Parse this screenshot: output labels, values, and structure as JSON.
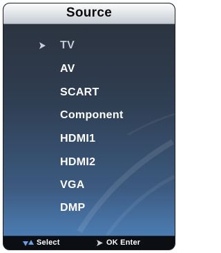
{
  "menu": {
    "title": "Source",
    "items": [
      {
        "label": "TV",
        "selected": true
      },
      {
        "label": "AV"
      },
      {
        "label": "SCART"
      },
      {
        "label": "Component"
      },
      {
        "label": "HDMI1"
      },
      {
        "label": "HDMI2"
      },
      {
        "label": "VGA"
      },
      {
        "label": "DMP"
      }
    ]
  },
  "footer": {
    "select_label": "Select",
    "enter_label": "OK Enter"
  },
  "icons": {
    "selection": "arrow-right-icon",
    "navigate": "up-down-arrows-icon",
    "enter": "arrow-right-icon"
  },
  "colors": {
    "title_bar": "#e6e9ec",
    "panel_top": "#2b313b",
    "panel_bottom": "#4f80b8",
    "item_text": "#ffffff",
    "selected_text": "#c4cad3",
    "footer_bg": "#0b0e13"
  }
}
